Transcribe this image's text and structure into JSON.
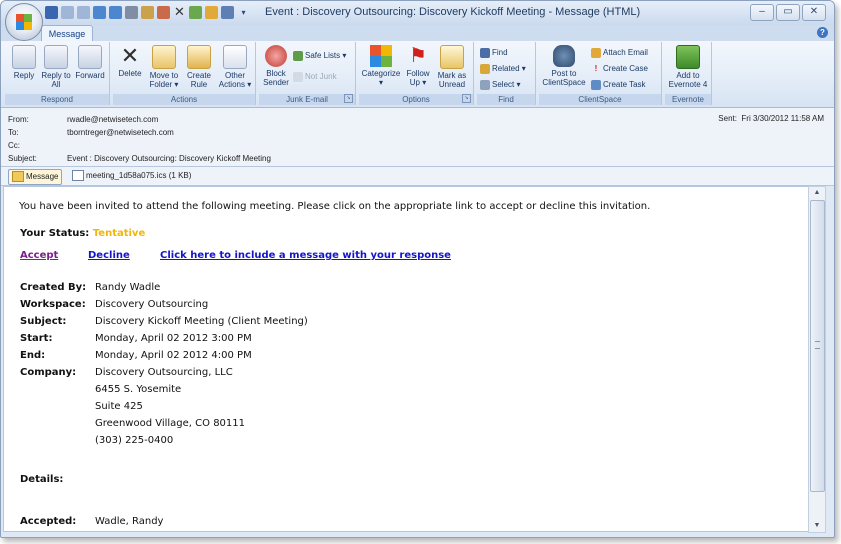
{
  "window": {
    "title": "Event : Discovery Outsourcing: Discovery Kickoff Meeting - Message (HTML)",
    "controls": {
      "minimize": "–",
      "restore": "▭",
      "close": "✕"
    }
  },
  "ribbon": {
    "active_tab": "Message",
    "help": "?",
    "groups": {
      "respond": "Respond",
      "actions": "Actions",
      "junk": "Junk E-mail",
      "options": "Options",
      "find": "Find",
      "clientspace": "ClientSpace",
      "evernote": "Evernote"
    },
    "buttons": {
      "reply": "Reply",
      "reply_all": "Reply to All",
      "forward": "Forward",
      "delete": "Delete",
      "move_to_folder": "Move to Folder ▾",
      "create_rule": "Create Rule",
      "other_actions": "Other Actions ▾",
      "block_sender": "Block Sender",
      "safe_lists": "Safe Lists ▾",
      "not_junk": "Not Junk",
      "categorize": "Categorize ▾",
      "follow_up": "Follow Up ▾",
      "mark_as_unread": "Mark as Unread",
      "find": "Find",
      "related": "Related ▾",
      "select": "Select ▾",
      "post_to_clientspace": "Post to ClientSpace",
      "attach_email": "Attach Email",
      "create_case": "Create Case",
      "create_task": "Create Task",
      "add_to_evernote": "Add to Evernote 4"
    }
  },
  "header": {
    "from_label": "From:",
    "from": "rwadle@netwisetech.com",
    "to_label": "To:",
    "to": "tborntreger@netwisetech.com",
    "cc_label": "Cc:",
    "cc": "",
    "subject_label": "Subject:",
    "subject": "Event : Discovery Outsourcing: Discovery Kickoff Meeting",
    "sent_label": "Sent:",
    "sent": "Fri 3/30/2012 11:58 AM"
  },
  "attachments": {
    "message_tab": "Message",
    "file": "meeting_1d58a075.ics (1 KB)"
  },
  "body": {
    "intro": "You have been invited to attend the following meeting. Please click on the appropriate link to accept or decline this invitation.",
    "status_label": "Your Status:",
    "status_value": "Tentative",
    "accept": "Accept",
    "decline": "Decline",
    "include_message": "Click here to include a message with your response",
    "fields": {
      "created_by_label": "Created By:",
      "created_by": "Randy Wadle",
      "workspace_label": "Workspace:",
      "workspace": "Discovery Outsourcing",
      "subject_label": "Subject:",
      "subject": "Discovery Kickoff Meeting (Client Meeting)",
      "start_label": "Start:",
      "start": "Monday, April 02 2012 3:00 PM",
      "end_label": "End:",
      "end": "Monday, April 02 2012 4:00 PM",
      "company_label": "Company:",
      "company": "Discovery Outsourcing, LLC",
      "address1": "6455 S. Yosemite",
      "address2": "Suite 425",
      "address3": "Greenwood Village, CO 80111",
      "phone": "(303) 225-0400",
      "details_label": "Details:",
      "accepted_label": "Accepted:",
      "accepted": "Wadle, Randy"
    }
  },
  "colors": {
    "tentative": "#f2b705",
    "link_blue": "#1515c8",
    "link_visited": "#7a1f8c",
    "ribbon_text": "#1b3a66"
  }
}
